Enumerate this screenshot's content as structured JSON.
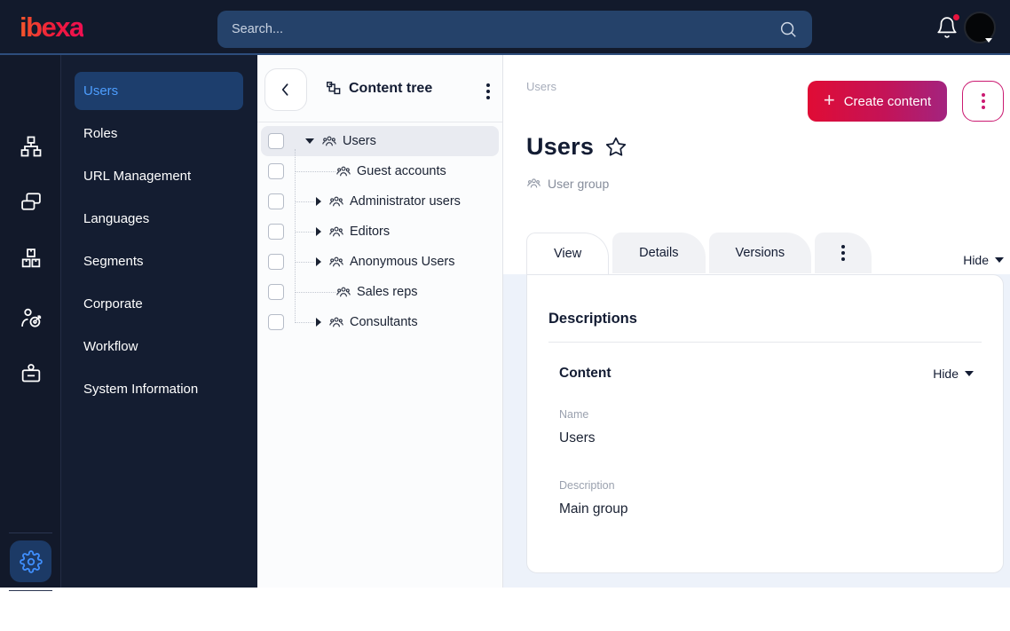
{
  "topbar": {
    "logo": "ibexa",
    "search_placeholder": "Search..."
  },
  "sidebar": {
    "items": [
      {
        "label": "Users",
        "active": true
      },
      {
        "label": "Roles"
      },
      {
        "label": "URL Management"
      },
      {
        "label": "Languages"
      },
      {
        "label": "Segments"
      },
      {
        "label": "Corporate"
      },
      {
        "label": "Workflow"
      },
      {
        "label": "System Information"
      }
    ]
  },
  "content_tree": {
    "title": "Content tree",
    "items": [
      {
        "label": "Users",
        "state": "expanded",
        "selected": true
      },
      {
        "label": "Guest accounts",
        "state": "leaf"
      },
      {
        "label": "Administrator users",
        "state": "collapsed"
      },
      {
        "label": "Editors",
        "state": "collapsed"
      },
      {
        "label": "Anonymous Users",
        "state": "collapsed"
      },
      {
        "label": "Sales reps",
        "state": "leaf"
      },
      {
        "label": "Consultants",
        "state": "collapsed"
      }
    ]
  },
  "main": {
    "breadcrumb": "Users",
    "create_button": "Create content",
    "title": "Users",
    "content_type": "User group",
    "tabs": [
      {
        "label": "View",
        "active": true
      },
      {
        "label": "Details"
      },
      {
        "label": "Versions"
      }
    ],
    "hide_label": "Hide",
    "card": {
      "section_title": "Descriptions",
      "group_title": "Content",
      "hide_label": "Hide",
      "fields": [
        {
          "label": "Name",
          "value": "Users"
        },
        {
          "label": "Description",
          "value": "Main group"
        }
      ]
    }
  },
  "colors": {
    "topbar_bg": "#121a2c",
    "accent_blue": "#4d9eff",
    "brand_gradient_start": "#e00c35",
    "brand_gradient_end": "#a3247f",
    "dark_navy": "#131c33",
    "notification_red": "#e8143f",
    "selected_row_bg": "#e9ebf1"
  }
}
